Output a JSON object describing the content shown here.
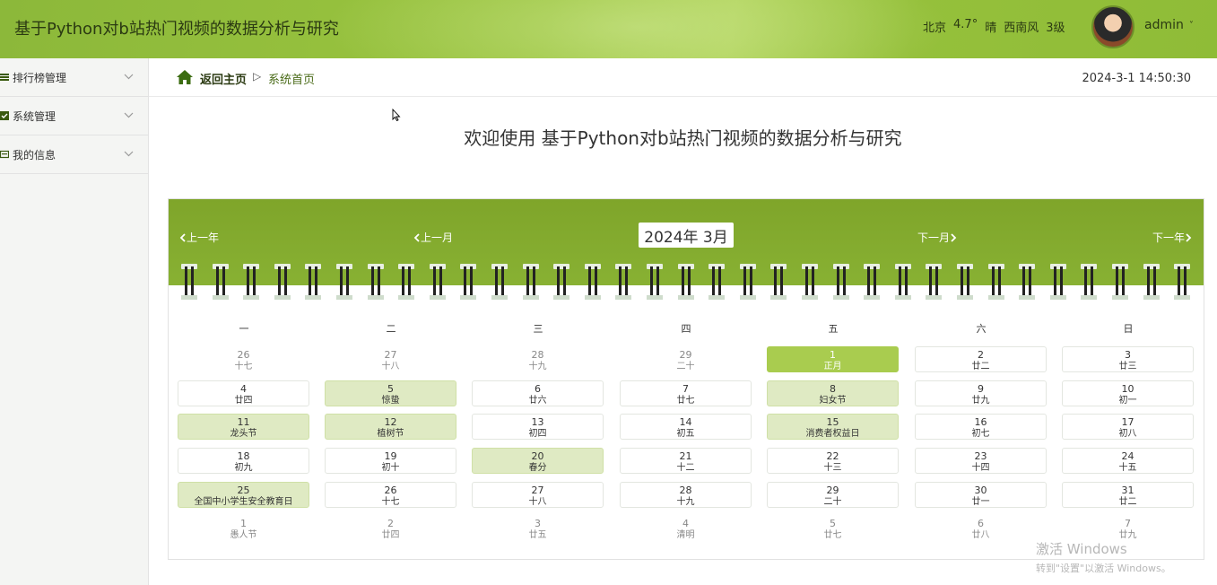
{
  "header": {
    "title": "基于Python对b站热门视频的数据分析与研究",
    "weather": {
      "city": "北京",
      "temp": "4.7°",
      "condition": "晴",
      "wind": "西南风",
      "level": "3级"
    },
    "username": "admin",
    "user_chevron": "˅"
  },
  "sidebar": {
    "items": [
      {
        "label": "排行榜管理",
        "icon": "list-icon"
      },
      {
        "label": "系统管理",
        "icon": "check-icon"
      },
      {
        "label": "我的信息",
        "icon": "card-icon"
      }
    ]
  },
  "breadcrumb": {
    "back_label": "返回主页",
    "separator": "▷",
    "current": "系统首页",
    "clock": "2024-3-1 14:50:30"
  },
  "welcome": "欢迎使用 基于Python对b站热门视频的数据分析与研究",
  "calendar": {
    "prev_year": "上一年",
    "prev_month": "上一月",
    "month_label": "2024年 3月",
    "next_month": "下一月",
    "next_year": "下一年",
    "weekdays": [
      "一",
      "二",
      "三",
      "四",
      "五",
      "六",
      "日"
    ],
    "days": [
      {
        "d": "26",
        "l": "十七",
        "t": "other"
      },
      {
        "d": "27",
        "l": "十八",
        "t": "other"
      },
      {
        "d": "28",
        "l": "十九",
        "t": "other"
      },
      {
        "d": "29",
        "l": "二十",
        "t": "other"
      },
      {
        "d": "1",
        "l": "正月",
        "t": "today"
      },
      {
        "d": "2",
        "l": "廿二",
        "t": "cur"
      },
      {
        "d": "3",
        "l": "廿三",
        "t": "cur"
      },
      {
        "d": "4",
        "l": "廿四",
        "t": "cur"
      },
      {
        "d": "5",
        "l": "惊蛰",
        "t": "fest"
      },
      {
        "d": "6",
        "l": "廿六",
        "t": "cur"
      },
      {
        "d": "7",
        "l": "廿七",
        "t": "cur"
      },
      {
        "d": "8",
        "l": "妇女节",
        "t": "fest"
      },
      {
        "d": "9",
        "l": "廿九",
        "t": "cur"
      },
      {
        "d": "10",
        "l": "初一",
        "t": "cur"
      },
      {
        "d": "11",
        "l": "龙头节",
        "t": "fest"
      },
      {
        "d": "12",
        "l": "植树节",
        "t": "fest"
      },
      {
        "d": "13",
        "l": "初四",
        "t": "cur"
      },
      {
        "d": "14",
        "l": "初五",
        "t": "cur"
      },
      {
        "d": "15",
        "l": "消费者权益日",
        "t": "fest"
      },
      {
        "d": "16",
        "l": "初七",
        "t": "cur"
      },
      {
        "d": "17",
        "l": "初八",
        "t": "cur"
      },
      {
        "d": "18",
        "l": "初九",
        "t": "cur"
      },
      {
        "d": "19",
        "l": "初十",
        "t": "cur"
      },
      {
        "d": "20",
        "l": "春分",
        "t": "fest"
      },
      {
        "d": "21",
        "l": "十二",
        "t": "cur"
      },
      {
        "d": "22",
        "l": "十三",
        "t": "cur"
      },
      {
        "d": "23",
        "l": "十四",
        "t": "cur"
      },
      {
        "d": "24",
        "l": "十五",
        "t": "cur"
      },
      {
        "d": "25",
        "l": "全国中小学生安全教育日",
        "t": "fest"
      },
      {
        "d": "26",
        "l": "十七",
        "t": "cur"
      },
      {
        "d": "27",
        "l": "十八",
        "t": "cur"
      },
      {
        "d": "28",
        "l": "十九",
        "t": "cur"
      },
      {
        "d": "29",
        "l": "二十",
        "t": "cur"
      },
      {
        "d": "30",
        "l": "廿一",
        "t": "cur"
      },
      {
        "d": "31",
        "l": "廿二",
        "t": "cur"
      },
      {
        "d": "1",
        "l": "愚人节",
        "t": "other"
      },
      {
        "d": "2",
        "l": "廿四",
        "t": "other"
      },
      {
        "d": "3",
        "l": "廿五",
        "t": "other"
      },
      {
        "d": "4",
        "l": "清明",
        "t": "other"
      },
      {
        "d": "5",
        "l": "廿七",
        "t": "other"
      },
      {
        "d": "6",
        "l": "廿八",
        "t": "other"
      },
      {
        "d": "7",
        "l": "廿九",
        "t": "other"
      }
    ]
  },
  "watermark": {
    "line1": "激活 Windows",
    "line2": "转到\"设置\"以激活 Windows。"
  },
  "colors": {
    "accent": "#8cb83a",
    "festival": "#dfeac3",
    "today": "#a9cc4f"
  }
}
